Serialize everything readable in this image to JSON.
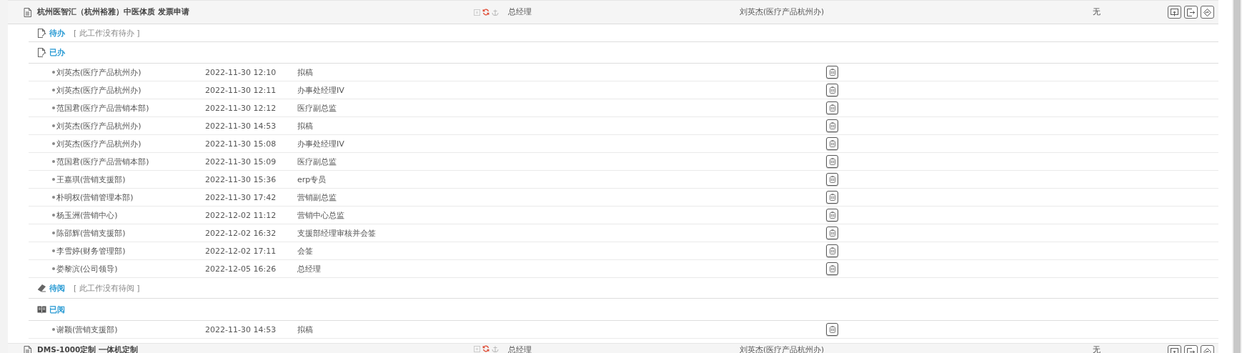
{
  "tasks": [
    {
      "title": "杭州医智汇（杭州裕雅）中医体质 发票申请",
      "approver": "总经理",
      "handler": "刘英杰(医疗产品杭州办)",
      "column_4": "无",
      "sections": [
        {
          "kind": "todo",
          "label": "待办",
          "empty_note": "[ 此工作没有待办 ]"
        },
        {
          "kind": "done",
          "label": "已办",
          "rows": [
            {
              "name": "刘英杰(医疗产品杭州办)",
              "time": "2022-11-30 12:10",
              "step": "拟稿"
            },
            {
              "name": "刘英杰(医疗产品杭州办)",
              "time": "2022-11-30 12:11",
              "step": "办事处经理IV"
            },
            {
              "name": "范国君(医疗产品营销本部)",
              "time": "2022-11-30 12:12",
              "step": "医疗副总监"
            },
            {
              "name": "刘英杰(医疗产品杭州办)",
              "time": "2022-11-30 14:53",
              "step": "拟稿"
            },
            {
              "name": "刘英杰(医疗产品杭州办)",
              "time": "2022-11-30 15:08",
              "step": "办事处经理IV"
            },
            {
              "name": "范国君(医疗产品营销本部)",
              "time": "2022-11-30 15:09",
              "step": "医疗副总监"
            },
            {
              "name": "王嘉琪(营销支援部)",
              "time": "2022-11-30 15:36",
              "step": "erp专员"
            },
            {
              "name": "朴明权(营销管理本部)",
              "time": "2022-11-30 17:42",
              "step": "营销副总监"
            },
            {
              "name": "杨玉洲(营销中心)",
              "time": "2022-12-02 11:12",
              "step": "营销中心总监"
            },
            {
              "name": "陈邵辉(营销支援部)",
              "time": "2022-12-02 16:32",
              "step": "支援部经理审核并会签"
            },
            {
              "name": "李雪婷(财务管理部)",
              "time": "2022-12-02 17:11",
              "step": "会签"
            },
            {
              "name": "娄黎滨(公司领导)",
              "time": "2022-12-05 16:26",
              "step": "总经理"
            }
          ]
        },
        {
          "kind": "to_read",
          "label": "待阅",
          "empty_note": "[ 此工作没有待阅 ]"
        },
        {
          "kind": "read",
          "label": "已阅",
          "rows": [
            {
              "name": "谢颖(营销支援部)",
              "time": "2022-11-30 14:53",
              "step": "拟稿"
            }
          ]
        }
      ]
    },
    {
      "title": "DMS-1000定制 一体机定制",
      "approver": "总经理",
      "handler": "刘英杰(医疗产品杭州办)",
      "column_4": "无"
    }
  ]
}
